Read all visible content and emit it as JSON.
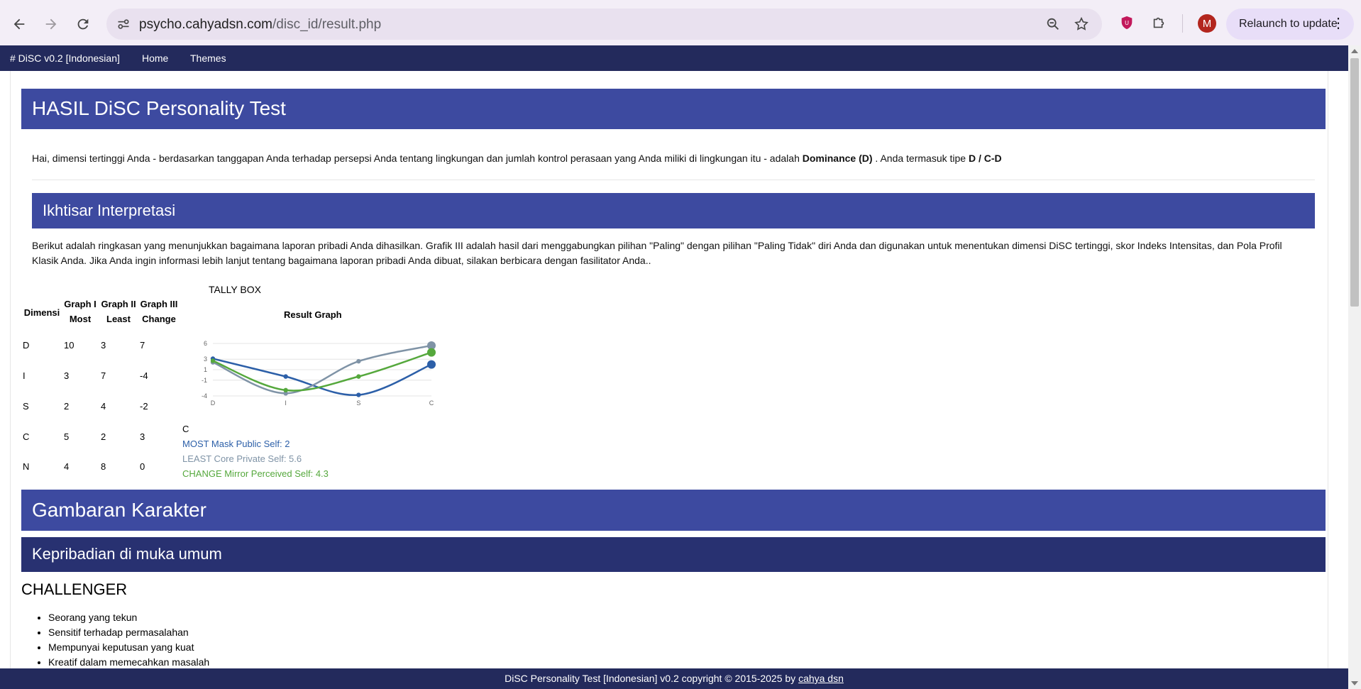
{
  "browser": {
    "url_host": "psycho.cahyadsn.com",
    "url_path": "/disc_id/result.php",
    "avatar_letter": "M",
    "relaunch_label": "Relaunch to update",
    "menu_glyph": "⋮"
  },
  "navbar": {
    "brand": "# DiSC v0.2 [Indonesian]",
    "links": [
      "Home",
      "Themes"
    ]
  },
  "page": {
    "title": "HASIL DiSC Personality Test",
    "intro_prefix": "Hai, dimensi tertinggi Anda - berdasarkan tanggapan Anda terhadap persepsi Anda tentang lingkungan dan jumlah kontrol perasaan yang Anda miliki di lingkungan itu - adalah ",
    "intro_dimension": "Dominance (D)",
    "intro_middle": " . Anda termasuk tipe ",
    "intro_type": "D / C-D",
    "summary_title": "Ikhtisar Interpretasi",
    "summary_text": "Berikut adalah ringkasan yang menunjukkan bagaimana laporan pribadi Anda dihasilkan. Grafik III adalah hasil dari menggabungkan pilihan \"Paling\" dengan pilihan \"Paling Tidak\" diri Anda dan digunakan untuk menentukan dimensi DiSC tertinggi, skor Indeks Intensitas, dan Pola Profil Klasik Anda. Jika Anda ingin informasi lebih lanjut tentang bagaimana laporan pribadi Anda dibuat, silakan berbicara dengan fasilitator Anda..",
    "tally_title": "TALLY BOX",
    "graph_title": "Result Graph",
    "legend_c": "C",
    "legend": [
      {
        "text": "MOST Mask Public Self: 2",
        "color": "#2c5fa8"
      },
      {
        "text": "LEAST Core Private Self: 5.6",
        "color": "#7f93a6"
      },
      {
        "text": "CHANGE Mirror Perceived Self: 4.3",
        "color": "#55a83c"
      }
    ],
    "section_title": "Gambaran Karakter",
    "subsection_title": "Kepribadian di muka umum",
    "personality_type": "CHALLENGER",
    "traits": [
      "Seorang yang tekun",
      "Sensitif terhadap permasalahan",
      "Mempunyai keputusan yang kuat",
      "Kreatif dalam memecahkan masalah"
    ]
  },
  "tally": {
    "headers": [
      {
        "line1": "Dimensi",
        "line2": ""
      },
      {
        "line1": "Graph I",
        "line2": "Most"
      },
      {
        "line1": "Graph II",
        "line2": "Least"
      },
      {
        "line1": "Graph III",
        "line2": "Change"
      }
    ],
    "rows": [
      [
        "D",
        "10",
        "3",
        "7"
      ],
      [
        "I",
        "3",
        "7",
        "-4"
      ],
      [
        "S",
        "2",
        "4",
        "-2"
      ],
      [
        "C",
        "5",
        "2",
        "3"
      ],
      [
        "N",
        "4",
        "8",
        "0"
      ]
    ]
  },
  "chart_data": {
    "type": "line",
    "title": "Result Graph",
    "categories": [
      "D",
      "I",
      "S",
      "C"
    ],
    "y_ticks": [
      6,
      3,
      1,
      -1,
      -4
    ],
    "ylim": [
      -4,
      6
    ],
    "grid": true,
    "series": [
      {
        "name": "MOST",
        "color": "#2c5fa8",
        "values": [
          3.1,
          -0.3,
          -3.8,
          2.0
        ]
      },
      {
        "name": "LEAST",
        "color": "#7f93a6",
        "values": [
          2.4,
          -3.5,
          2.6,
          5.6
        ]
      },
      {
        "name": "CHANGE",
        "color": "#55a83c",
        "values": [
          2.7,
          -2.9,
          -0.3,
          4.3
        ]
      }
    ]
  },
  "footer": {
    "text": "DiSC Personality Test [Indonesian] v0.2 copyright © 2015-2025 by ",
    "link": "cahya dsn"
  }
}
